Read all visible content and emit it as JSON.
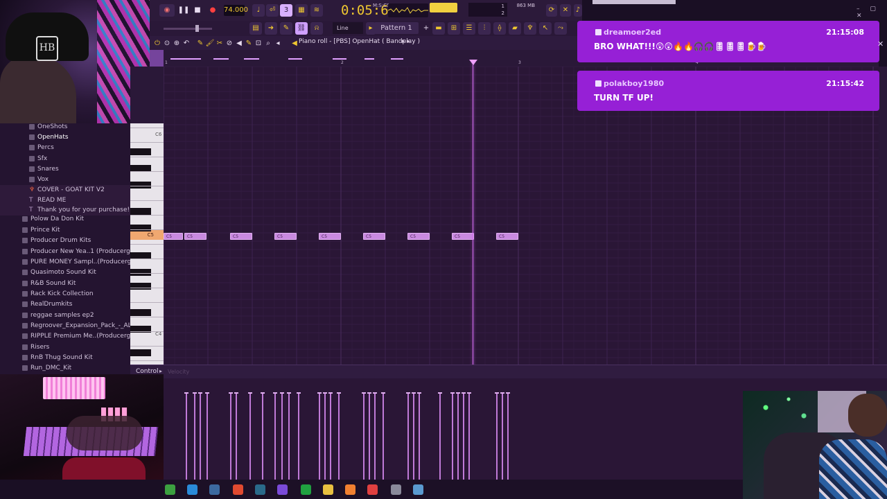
{
  "transport": {
    "tempo": "74.000",
    "time": "0:05:64",
    "time_unit": "M:S:CS",
    "memory": "863 MB",
    "cpu_line1": "1",
    "cpu_line2": "2",
    "snap_mode": "Line",
    "pattern": "Pattern 1"
  },
  "piano_roll": {
    "title": "Piano roll - [PBS] OpenHat ( Bandplay )",
    "bar_numbers": [
      "1",
      "2",
      "3",
      "4"
    ],
    "octave_labels": {
      "c6": "C6",
      "c5": "C5",
      "c4": "C4"
    },
    "note_label": "C5",
    "control_label": "Control",
    "velocity_label": "Velocity"
  },
  "browser": {
    "items": [
      {
        "label": "OneShots",
        "type": "folder",
        "indent": 1
      },
      {
        "label": "OpenHats",
        "type": "folder",
        "indent": 1,
        "selected": true
      },
      {
        "label": "Percs",
        "type": "folder",
        "indent": 1
      },
      {
        "label": "Sfx",
        "type": "folder",
        "indent": 1
      },
      {
        "label": "Snares",
        "type": "folder",
        "indent": 1
      },
      {
        "label": "Vox",
        "type": "folder",
        "indent": 1
      },
      {
        "label": "COVER - GOAT KIT V2",
        "type": "kit",
        "indent": 1
      },
      {
        "label": "READ ME",
        "type": "text",
        "indent": 1
      },
      {
        "label": "Thank you for your purchase!",
        "type": "text",
        "indent": 1
      },
      {
        "label": "Polow Da Don Kit",
        "type": "folder",
        "indent": 0
      },
      {
        "label": "Prince Kit",
        "type": "folder",
        "indent": 0
      },
      {
        "label": "Producer Drum Kits",
        "type": "folder",
        "indent": 0
      },
      {
        "label": "Producer New Yea..1 (Producergrind)",
        "type": "folder",
        "indent": 0
      },
      {
        "label": "PURE MONEY Sampl..(Producergrind)",
        "type": "folder",
        "indent": 0
      },
      {
        "label": "Quasimoto Sound Kit",
        "type": "folder",
        "indent": 0
      },
      {
        "label": "R&B Sound Kit",
        "type": "folder",
        "indent": 0
      },
      {
        "label": "Rack Kick Collection",
        "type": "folder",
        "indent": 0
      },
      {
        "label": "RealDrumkits",
        "type": "folder",
        "indent": 0
      },
      {
        "label": "reggae samples ep2",
        "type": "folder",
        "indent": 0
      },
      {
        "label": "Regroover_Expansion_Pack_-_ALPHA",
        "type": "folder",
        "indent": 0
      },
      {
        "label": "RIPPLE Premium Me..(Producergrind)",
        "type": "folder",
        "indent": 0
      },
      {
        "label": "Risers",
        "type": "folder",
        "indent": 0
      },
      {
        "label": "RnB Thug Sound Kit",
        "type": "folder",
        "indent": 0
      },
      {
        "label": "Run_DMC_Kit",
        "type": "folder",
        "indent": 0
      }
    ]
  },
  "chat": [
    {
      "user": "dreamoer2ed",
      "time": "21:15:08",
      "message": "BRO WHAT!!!😲😲🔥🔥🎧🎧🎚🎚🎚🍺🍺"
    },
    {
      "user": "polakboy1980",
      "time": "21:15:42",
      "message": "TURN TF UP!"
    }
  ],
  "colors": {
    "accent": "#9620d6",
    "note": "#c98ae0",
    "playhead": "#d46cf0",
    "transport_yellow": "#f0c830"
  },
  "taskbar_icons": [
    "upwork-icon",
    "edge-icon",
    "steam-icon",
    "chrome-icon",
    "app-icon",
    "arc-icon",
    "xbox-icon",
    "file-explorer-icon",
    "fl-studio-icon",
    "recorder-icon",
    "window-icon",
    "obs-icon"
  ]
}
